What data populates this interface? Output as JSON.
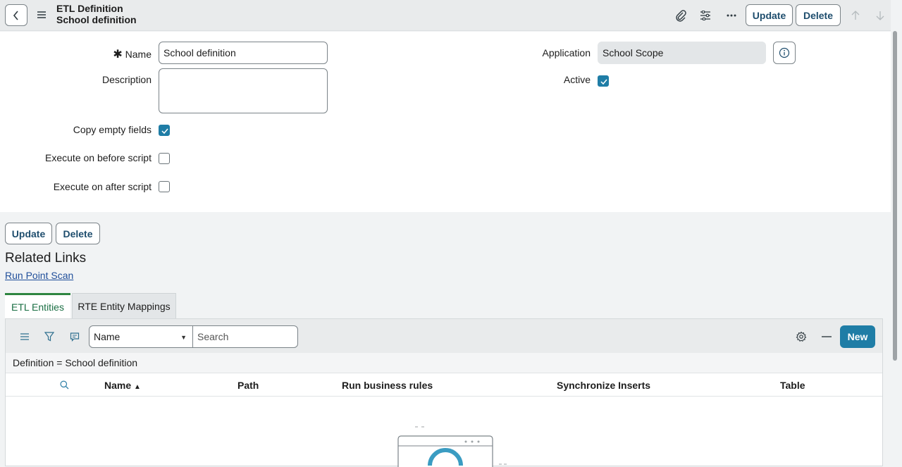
{
  "header": {
    "title": "ETL Definition",
    "subtitle": "School definition",
    "update_label": "Update",
    "delete_label": "Delete"
  },
  "form": {
    "name_label": "Name",
    "name_value": "School definition",
    "description_label": "Description",
    "description_value": "",
    "copy_empty_label": "Copy empty fields",
    "copy_empty_checked": true,
    "exec_before_label": "Execute on before script",
    "exec_before_checked": false,
    "exec_after_label": "Execute on after script",
    "exec_after_checked": false,
    "application_label": "Application",
    "application_value": "School Scope",
    "active_label": "Active",
    "active_checked": true
  },
  "actions": {
    "update_label": "Update",
    "delete_label": "Delete"
  },
  "related": {
    "title": "Related Links",
    "link": "Run Point Scan"
  },
  "tabs": [
    {
      "label": "ETL Entities",
      "active": true
    },
    {
      "label": "RTE Entity Mappings",
      "active": false
    }
  ],
  "list": {
    "select_value": "Name",
    "search_placeholder": "Search",
    "new_label": "New",
    "filter_text": "Definition = School definition",
    "columns": [
      "Name",
      "Path",
      "Run business rules",
      "Synchronize Inserts",
      "Table"
    ]
  },
  "colors": {
    "accent": "#1f7da6",
    "button_text": "#1e4d6d",
    "link": "#1f4e9a",
    "active_tab": "#2e8540"
  }
}
